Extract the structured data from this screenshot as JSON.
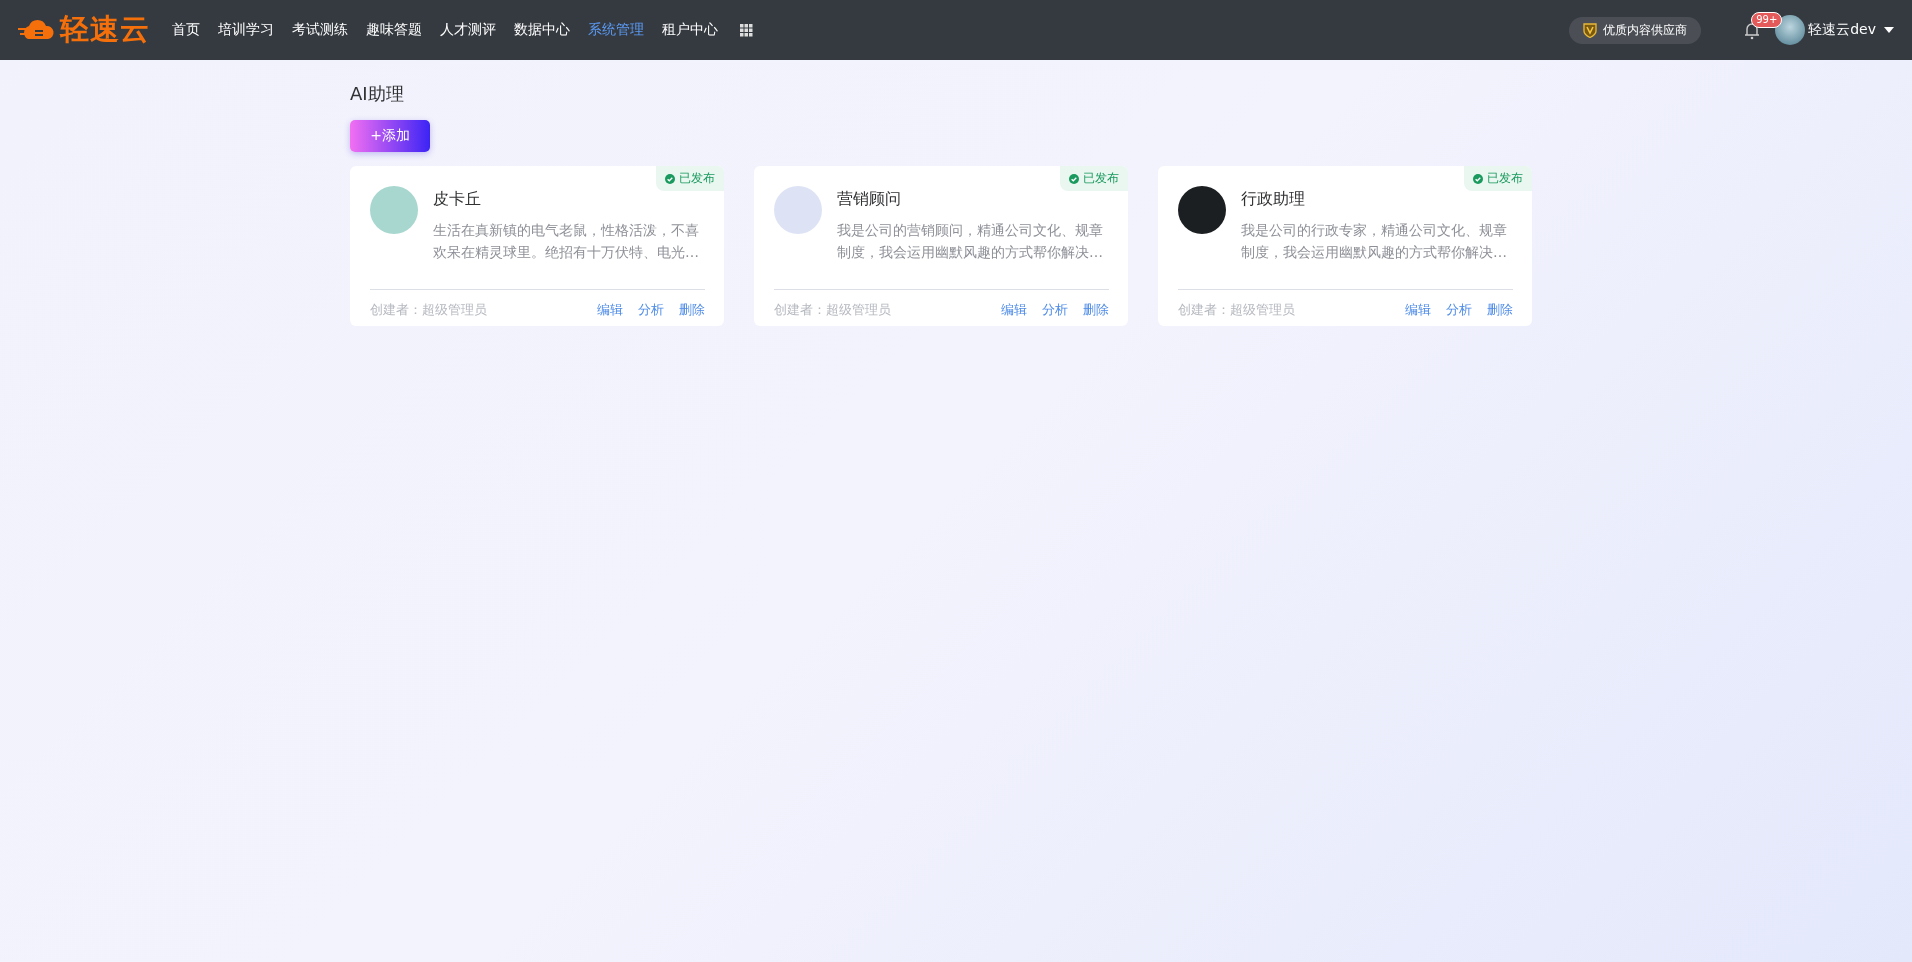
{
  "header": {
    "logo": "轻速云",
    "nav": [
      {
        "label": "首页",
        "selected": false
      },
      {
        "label": "培训学习",
        "selected": false
      },
      {
        "label": "考试测练",
        "selected": false
      },
      {
        "label": "趣味答题",
        "selected": false
      },
      {
        "label": "人才测评",
        "selected": false
      },
      {
        "label": "数据中心",
        "selected": false
      },
      {
        "label": "系统管理",
        "selected": true
      },
      {
        "label": "租户中心",
        "selected": false
      }
    ],
    "provider_badge": "优质内容供应商",
    "notification_count": "99+",
    "user_name": "轻速云dev"
  },
  "page": {
    "title": "AI助理",
    "add_button": "+添加"
  },
  "assistants": [
    {
      "name": "皮卡丘",
      "status": "已发布",
      "description": "生活在真新镇的电气老鼠，性格活泼，不喜欢呆在精灵球里。绝招有十万伏特、电光…",
      "creator": "创建者：超级管理员",
      "actions": [
        "编辑",
        "分析",
        "删除"
      ]
    },
    {
      "name": "营销顾问",
      "status": "已发布",
      "description": "我是公司的营销顾问，精通公司文化、规章制度，我会运用幽默风趣的方式帮你解决…",
      "creator": "创建者：超级管理员",
      "actions": [
        "编辑",
        "分析",
        "删除"
      ]
    },
    {
      "name": "行政助理",
      "status": "已发布",
      "description": "我是公司的行政专家，精通公司文化、规章制度，我会运用幽默风趣的方式帮你解决…",
      "creator": "创建者：超级管理员",
      "actions": [
        "编辑",
        "分析",
        "删除"
      ]
    }
  ]
}
